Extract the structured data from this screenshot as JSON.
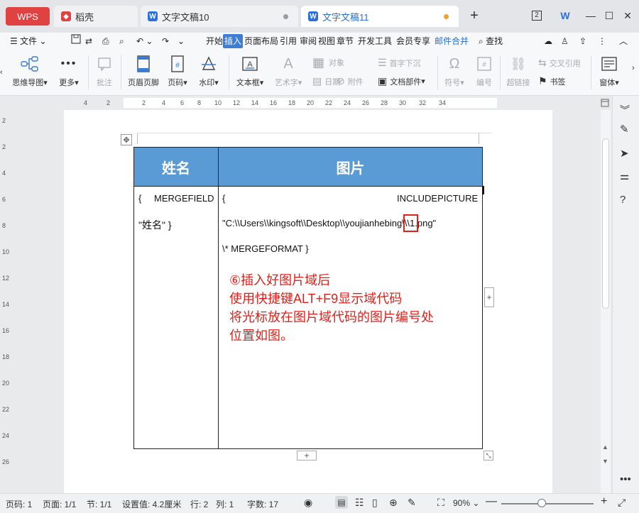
{
  "tabs": [
    {
      "label": "WPS"
    },
    {
      "label": "稻壳"
    },
    {
      "label": "文字文稿10"
    },
    {
      "label": "文字文稿11"
    }
  ],
  "window": {
    "badge": "2"
  },
  "menu": {
    "file": "文件",
    "items": [
      "开始",
      "插入",
      "页面布局",
      "引用",
      "审阅",
      "视图",
      "章节",
      "开发工具",
      "会员专享",
      "邮件合并"
    ],
    "search": "查找"
  },
  "ribbon": {
    "mindmap": "思维导图",
    "more": "更多",
    "comment": "批注",
    "header_footer": "页眉页脚",
    "page_num": "页码",
    "watermark": "水印",
    "textbox": "文本框",
    "wordart": "艺术字",
    "object": "对象",
    "drop_cap": "首字下沉",
    "date": "日期",
    "attachment": "附件",
    "doc_parts": "文档部件",
    "symbol": "符号",
    "numbering": "编号",
    "hyperlink": "超链接",
    "cross_ref": "交叉引用",
    "bookmark": "书签",
    "window": "窗体"
  },
  "ruler": {
    "ticks": [
      "4",
      "2",
      "2",
      "4",
      "6",
      "8",
      "10",
      "12",
      "14",
      "16",
      "18",
      "20",
      "22",
      "24",
      "26",
      "28",
      "30",
      "32",
      "34"
    ],
    "vticks": [
      "2",
      "2",
      "4",
      "6",
      "8",
      "10",
      "12",
      "14",
      "16",
      "18",
      "20",
      "22",
      "24",
      "26"
    ]
  },
  "table": {
    "col1_header": "姓名",
    "col2_header": "图片",
    "cell1_line1_brace": "{",
    "cell1_line1_text": "MERGEFIELD",
    "cell1_line2": "\"姓名\"  }",
    "cell2_line1_brace": "{",
    "cell2_line1_text": "INCLUDEPICTURE",
    "cell2_line2_pre": "\"C:\\\\Users\\\\kingsoft\\\\Desktop\\\\youjianhebing\\\\",
    "cell2_line2_hl": "\\1",
    "cell2_line2_post": ".png\"",
    "cell2_line3": "\\* MERGEFORMAT  }"
  },
  "annotation": [
    "⑥插入好图片域后",
    "使用快捷键ALT+F9显示域代码",
    "将光标放在图片域代码的图片编号处",
    "位置如图。"
  ],
  "status": {
    "page": "页码: 1",
    "pages": "页面: 1/1",
    "section": "节: 1/1",
    "setting": "设置值: 4.2厘米",
    "row": "行: 2",
    "col": "列: 1",
    "words": "字数: 17",
    "zoom": "90%"
  },
  "colors": {
    "accent": "#3d7dd8",
    "header_fill": "#5b9bd5",
    "annotation": "#e0201a",
    "wps": "#e04141"
  }
}
